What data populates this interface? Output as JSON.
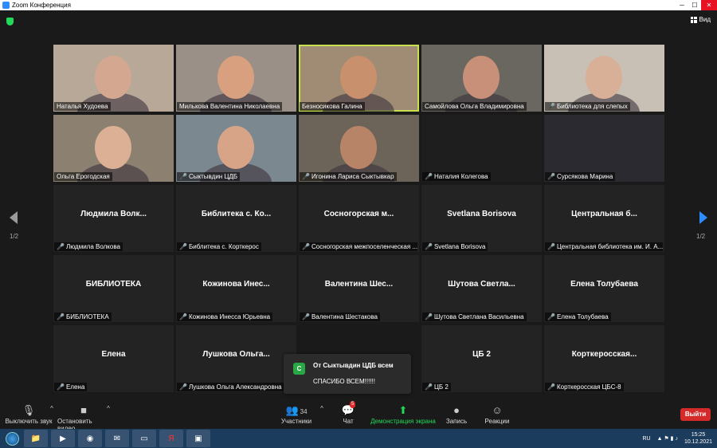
{
  "window": {
    "title": "Zoom Конференция"
  },
  "topbar": {
    "view_label": "Вид"
  },
  "pagination": {
    "left": "1/2",
    "right": "1/2"
  },
  "tiles": [
    {
      "name": "Наталья Худоева",
      "muted": false,
      "video": true,
      "bg": "#b8a898",
      "face": "#d4a890"
    },
    {
      "name": "Милькова Валентина Николаевна",
      "muted": false,
      "video": true,
      "bg": "#9a9088",
      "face": "#d9a080"
    },
    {
      "name": "Безносикова Галина",
      "muted": false,
      "video": true,
      "active": true,
      "bg": "#a08c74",
      "face": "#c8906c"
    },
    {
      "name": "Самойлова Ольга Владимировна",
      "muted": false,
      "video": true,
      "bg": "#6a6660",
      "face": "#c89078"
    },
    {
      "name": "Библиотека для слепых",
      "muted": true,
      "video": true,
      "bg": "#c8c0b4",
      "face": "#d8b098"
    },
    {
      "name": "Ольга Ерогодская",
      "muted": false,
      "video": true,
      "bg": "#8c8070",
      "face": "#dcb094"
    },
    {
      "name": "Сыктывдин ЦДБ",
      "muted": true,
      "video": true,
      "bg": "#7c8890",
      "face": "#d8a488"
    },
    {
      "name": "Игонина Лариса Сыктывкар",
      "muted": true,
      "video": true,
      "bg": "#6c6458",
      "face": "#b88468"
    },
    {
      "name": "Наталия Колегова",
      "muted": true,
      "video": true,
      "bg": "#1e1e1e",
      "face": ""
    },
    {
      "name": "Сурсякова Марина",
      "muted": true,
      "video": true,
      "bg": "#2a2a30",
      "face": ""
    },
    {
      "name": "Людмила Волкова",
      "display": "Людмила Волк...",
      "muted": true,
      "video": false
    },
    {
      "name": "Библитека с. Корткерос",
      "display": "Библитека с. Ко...",
      "muted": true,
      "video": false
    },
    {
      "name": "Сосногорская межпоселенческая ...",
      "display": "Сосногорская м...",
      "muted": true,
      "video": false
    },
    {
      "name": "Svetlana Borisova",
      "display": "Svetlana Borisova",
      "muted": true,
      "video": false
    },
    {
      "name": "Центральная библиотека им. И. А...",
      "display": "Центральная б...",
      "muted": true,
      "video": false
    },
    {
      "name": "БИБЛИОТЕКА",
      "display": "БИБЛИОТЕКА",
      "muted": true,
      "video": false
    },
    {
      "name": "Кожинова Инесса Юрьевна",
      "display": "Кожинова Инес...",
      "muted": true,
      "video": false
    },
    {
      "name": "Валентина Шестакова",
      "display": "Валентина Шес...",
      "muted": true,
      "video": false
    },
    {
      "name": "Шутова Светлана Васильевна",
      "display": "Шутова Светла...",
      "muted": true,
      "video": false
    },
    {
      "name": "Елена Толубаева",
      "display": "Елена Толубаева",
      "muted": true,
      "video": false
    },
    {
      "name": "Елена",
      "display": "Елена",
      "muted": true,
      "video": false
    },
    {
      "name": "Лушкова Ольга Александровна",
      "display": "Лушкова Ольга...",
      "muted": true,
      "video": false
    },
    {
      "name": "",
      "display": "",
      "muted": false,
      "video": false,
      "hidden": true
    },
    {
      "name": "ЦБ 2",
      "display": "ЦБ 2",
      "muted": true,
      "video": false
    },
    {
      "name": "Корткеросская ЦБС-8",
      "display": "Корткеросская...",
      "muted": true,
      "video": false
    }
  ],
  "chat_toast": {
    "avatar": "С",
    "header": "От Сыктывдин ЦДБ всем",
    "message": "СПАСИБО ВСЕМ!!!!!!"
  },
  "toolbar": {
    "mute": "Выключить звук",
    "video": "Остановить видео",
    "participants": "Участники",
    "participants_count": "34",
    "chat": "Чат",
    "chat_badge": "5",
    "share": "Демонстрация экрана",
    "record": "Запись",
    "reactions": "Реакции",
    "leave": "Выйти"
  },
  "taskbar": {
    "lang": "RU",
    "time": "15:25",
    "date": "10.12.2021"
  },
  "colors": {
    "accent": "#2d8cff",
    "share_green": "#23d959",
    "leave_red": "#d42a2a",
    "active_speaker": "#c8e050"
  }
}
